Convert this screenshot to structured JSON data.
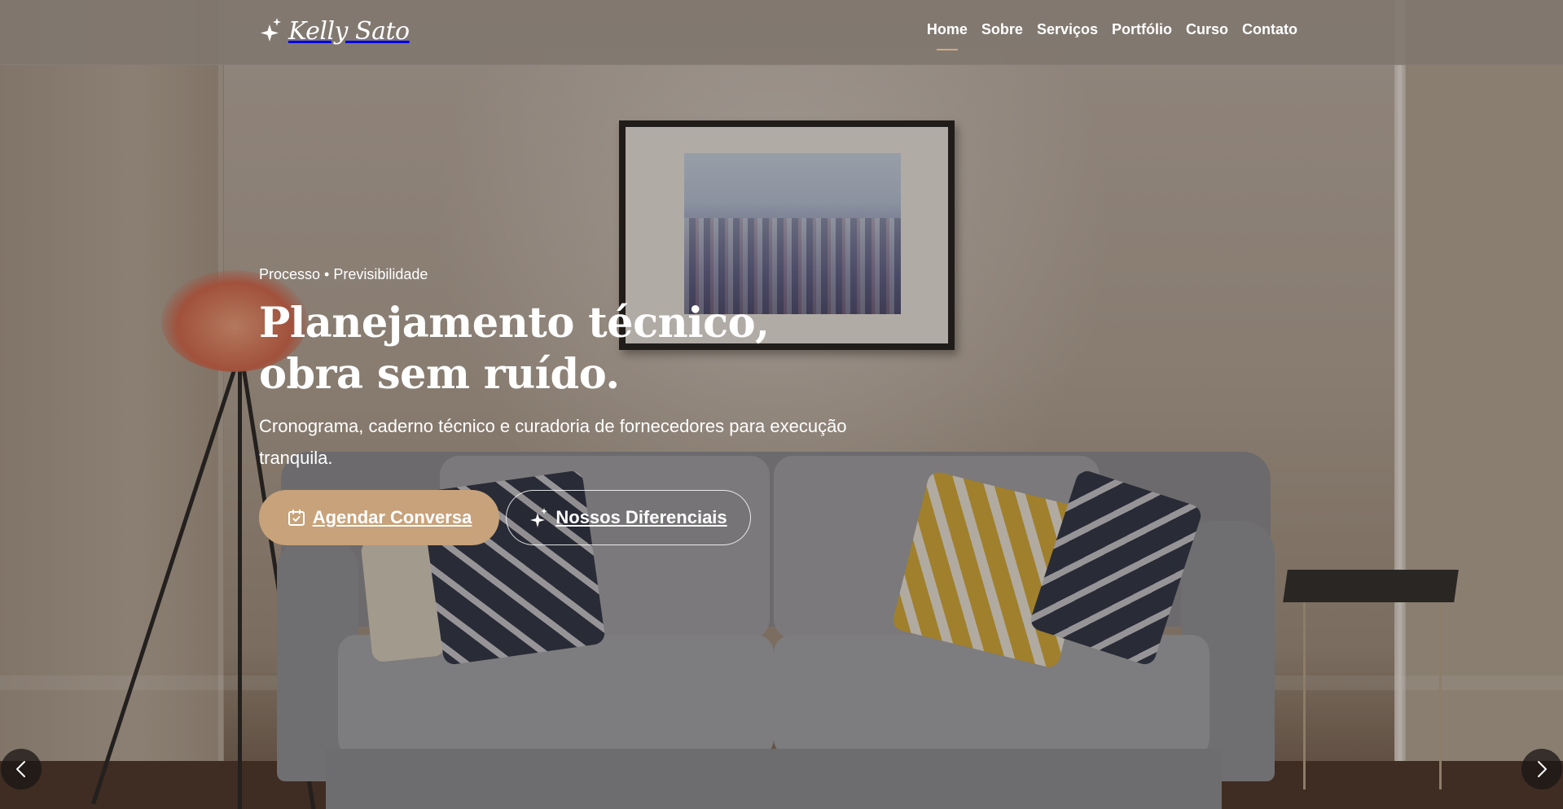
{
  "brand": {
    "name": "Kelly Sato",
    "icon": "sparkle-icon"
  },
  "nav": {
    "items": [
      {
        "label": "Home",
        "active": true
      },
      {
        "label": "Sobre",
        "active": false
      },
      {
        "label": "Serviços",
        "active": false
      },
      {
        "label": "Portfólio",
        "active": false
      },
      {
        "label": "Curso",
        "active": false
      },
      {
        "label": "Contato",
        "active": false
      }
    ]
  },
  "hero": {
    "eyebrow": "Processo • Previsibilidade",
    "headline": "Planejamento técnico, obra sem ruído.",
    "subtitle": "Cronograma, caderno técnico e curadoria de fornecedores para execução tranquila.",
    "primary_button": {
      "label": "Agendar Conversa",
      "icon": "calendar-check-icon"
    },
    "secondary_button": {
      "label": "Nossos Diferenciais",
      "icon": "sparkle-icon"
    }
  },
  "carousel": {
    "prev_icon": "chevron-left-icon",
    "next_icon": "chevron-right-icon"
  },
  "colors": {
    "accent": "#c8a27a",
    "navbar": "#80766e",
    "active_underline": "#d2a97d"
  }
}
